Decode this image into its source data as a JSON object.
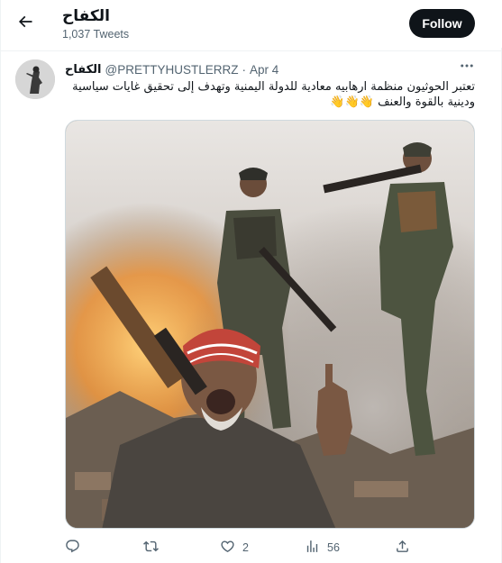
{
  "header": {
    "title": "الكفاح",
    "tweets_count": "1,037 Tweets",
    "follow_label": "Follow",
    "back_icon": "arrow-left-icon"
  },
  "tweet": {
    "author_name": "الكفاح",
    "author_handle": "@PRETTYHUSTLERRZ",
    "separator": "·",
    "date": "Apr 4",
    "text_line1": "تعتبر الحوثيون منظمة ارهابيه معادية للدولة اليمنية وتهدف إلى تحقيق غايات سياسية",
    "text_line2": "ودينية بالقوة والعنف",
    "emojis": "👋👋👋",
    "media_description_icon": "photo-image"
  },
  "actions": {
    "reply": {
      "icon": "reply-icon",
      "count": ""
    },
    "retweet": {
      "icon": "retweet-icon",
      "count": ""
    },
    "like": {
      "icon": "heart-icon",
      "count": "2"
    },
    "views": {
      "icon": "views-chart-icon",
      "count": "56"
    },
    "share": {
      "icon": "share-icon",
      "count": ""
    }
  },
  "colors": {
    "text_primary": "#0f1419",
    "text_secondary": "#536471",
    "follow_bg": "#0f1419",
    "border": "#eff3f4"
  }
}
